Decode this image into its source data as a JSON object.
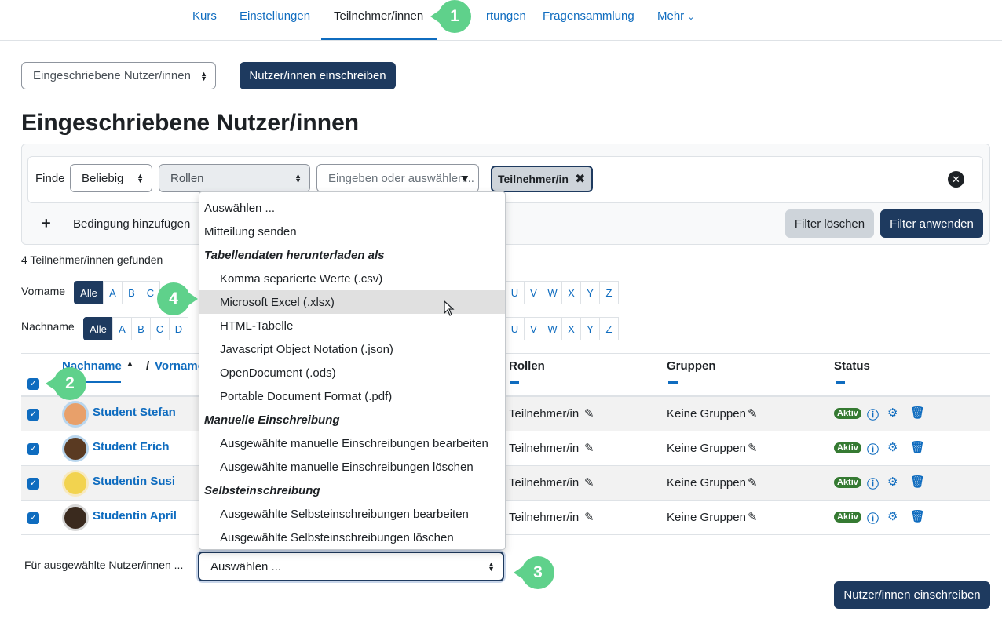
{
  "nav": {
    "tabs": [
      "Kurs",
      "Einstellungen",
      "Teilnehmer/innen",
      "Bewertungen",
      "Fragensammlung"
    ],
    "tab_behind_callout": "rtungen",
    "more": "Mehr"
  },
  "toolbar": {
    "enrolled_select": "Eingeschriebene Nutzer/innen",
    "enrol_button": "Nutzer/innen einschreiben"
  },
  "page_title": "Eingeschriebene Nutzer/innen",
  "filter": {
    "find_label": "Finde",
    "match_select": "Beliebig",
    "type_select": "Rollen",
    "value_placeholder": "Eingeben oder auswählen...",
    "chip": "Teilnehmer/in",
    "add_condition": "Bedingung hinzufügen",
    "clear_button": "Filter löschen",
    "apply_button": "Filter anwenden"
  },
  "count_text": "4 Teilnehmer/innen gefunden",
  "firstname_filter": {
    "label": "Vorname",
    "all": "Alle",
    "letters_left": [
      "A",
      "B",
      "C"
    ],
    "letters_right": [
      "U",
      "V",
      "W",
      "X",
      "Y",
      "Z"
    ]
  },
  "lastname_filter": {
    "label": "Nachname",
    "all": "Alle",
    "letters_left": [
      "A",
      "B",
      "C",
      "D"
    ],
    "letters_right": [
      "U",
      "V",
      "W",
      "X",
      "Y",
      "Z"
    ]
  },
  "table": {
    "col_lastname": "Nachname",
    "col_sep": "/",
    "col_firstname": "Vorname",
    "col_roles": "Rollen",
    "col_groups": "Gruppen",
    "col_status": "Status",
    "rows": [
      {
        "name": "Student Stefan",
        "role": "Teilnehmer/in",
        "groups": "Keine Gruppen",
        "status": "Aktiv"
      },
      {
        "name": "Student Erich",
        "role": "Teilnehmer/in",
        "groups": "Keine Gruppen",
        "status": "Aktiv"
      },
      {
        "name": "Studentin Susi",
        "role": "Teilnehmer/in",
        "groups": "Keine Gruppen",
        "status": "Aktiv"
      },
      {
        "name": "Studentin April",
        "role": "Teilnehmer/in",
        "groups": "Keine Gruppen",
        "status": "Aktiv"
      }
    ]
  },
  "bulk": {
    "label": "Für ausgewählte Nutzer/innen ...",
    "select_value": "Auswählen ...",
    "enrol_button": "Nutzer/innen einschreiben"
  },
  "dropdown": {
    "items": [
      {
        "label": "Auswählen ...",
        "type": "option"
      },
      {
        "label": "Mitteilung senden",
        "type": "option"
      },
      {
        "label": "Tabellendaten herunterladen als",
        "type": "group"
      },
      {
        "label": "Komma separierte Werte (.csv)",
        "type": "sub"
      },
      {
        "label": "Microsoft Excel (.xlsx)",
        "type": "sub",
        "highlighted": true
      },
      {
        "label": "HTML-Tabelle",
        "type": "sub"
      },
      {
        "label": "Javascript Object Notation (.json)",
        "type": "sub"
      },
      {
        "label": "OpenDocument (.ods)",
        "type": "sub"
      },
      {
        "label": "Portable Document Format (.pdf)",
        "type": "sub"
      },
      {
        "label": "Manuelle Einschreibung",
        "type": "group"
      },
      {
        "label": "Ausgewählte manuelle Einschreibungen bearbeiten",
        "type": "sub"
      },
      {
        "label": "Ausgewählte manuelle Einschreibungen löschen",
        "type": "sub"
      },
      {
        "label": "Selbsteinschreibung",
        "type": "group"
      },
      {
        "label": "Ausgewählte Selbsteinschreibungen bearbeiten",
        "type": "sub"
      },
      {
        "label": "Ausgewählte Selbsteinschreibungen löschen",
        "type": "sub"
      }
    ]
  },
  "callouts": [
    "1",
    "2",
    "3",
    "4"
  ],
  "colors": {
    "primary": "#1e3a5f",
    "link": "#0f6cbf",
    "success": "#357a32",
    "callout": "#5fd18b"
  }
}
